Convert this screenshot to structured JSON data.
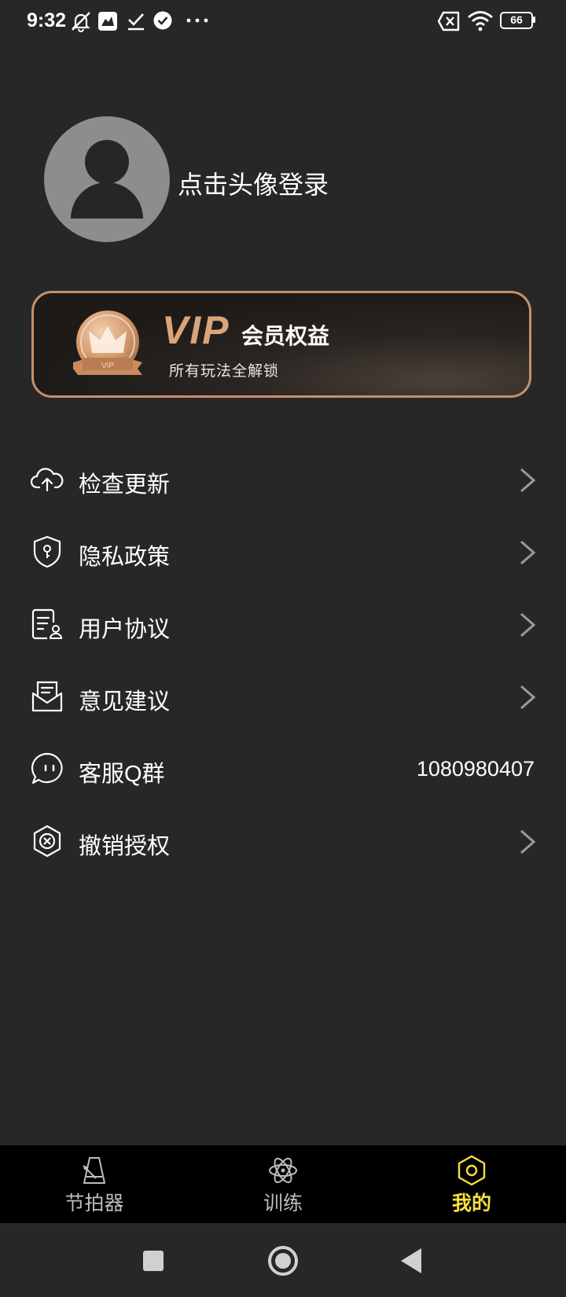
{
  "status_bar": {
    "time": "9:32",
    "battery": "66",
    "left_icons": [
      "bell-muted-icon",
      "app-icon",
      "download-check-icon",
      "check-circle-icon",
      "more-dots-icon"
    ],
    "right_icons": [
      "sim-x-icon",
      "wifi-icon",
      "battery-icon"
    ]
  },
  "profile": {
    "login_text": "点击头像登录"
  },
  "vip": {
    "badge_text": "VIP",
    "word": "VIP",
    "title": "会员权益",
    "subtitle": "所有玩法全解锁",
    "accent": "#c99069"
  },
  "menu": [
    {
      "label": "检查更新",
      "icon": "cloud-upload-icon",
      "chevron": true
    },
    {
      "label": "隐私政策",
      "icon": "shield-key-icon",
      "chevron": true
    },
    {
      "label": "用户协议",
      "icon": "document-user-icon",
      "chevron": true
    },
    {
      "label": "意见建议",
      "icon": "mail-feedback-icon",
      "chevron": true
    },
    {
      "label": "客服Q群",
      "icon": "chat-bubble-icon",
      "value": "1080980407"
    },
    {
      "label": "撤销授权",
      "icon": "revoke-auth-icon",
      "chevron": true
    }
  ],
  "tabs": [
    {
      "label": "节拍器",
      "icon": "metronome-icon"
    },
    {
      "label": "训练",
      "icon": "atom-icon"
    },
    {
      "label": "我的",
      "icon": "hexagon-icon",
      "active": true
    }
  ],
  "colors": {
    "background": "#272727",
    "active_tab": "#f7e13c",
    "tab_bar": "#000000"
  }
}
